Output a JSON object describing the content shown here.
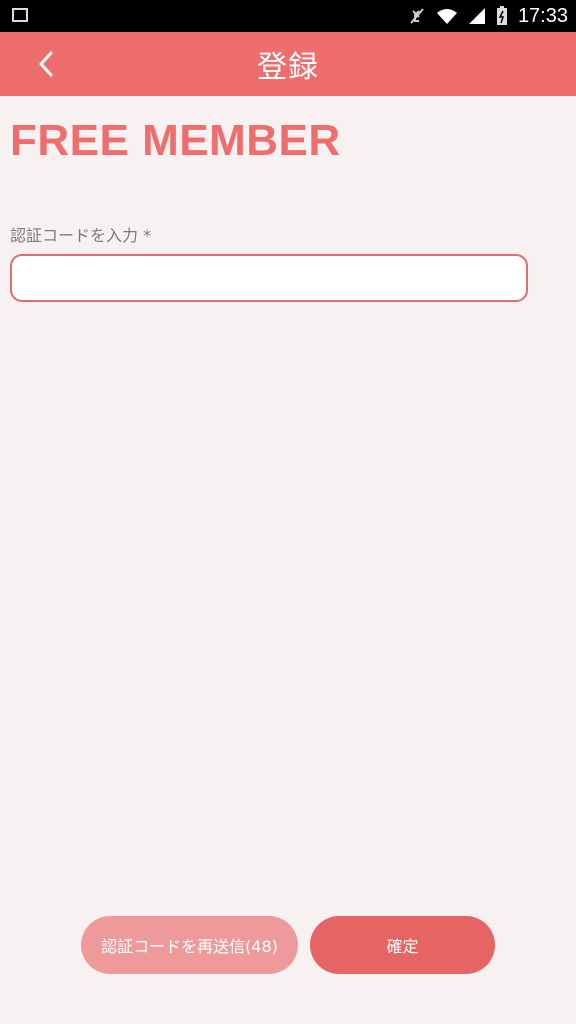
{
  "status_bar": {
    "time": "17:33",
    "icons": [
      "image-icon",
      "mute-icon",
      "wifi-icon",
      "signal-icon",
      "battery-icon"
    ]
  },
  "app_bar": {
    "title": "登録",
    "back_icon": "chevron-left-icon"
  },
  "main": {
    "heading": "FREE MEMBER",
    "code_field": {
      "label": "認証コードを入力 *",
      "value": "",
      "placeholder": ""
    }
  },
  "actions": {
    "resend_label": "認証コードを再送信(48)",
    "confirm_label": "確定"
  },
  "colors": {
    "accent": "#ee6e6e",
    "resend_button": "#ef9a9a",
    "confirm_button": "#e76464",
    "background": "#f8f1f1"
  }
}
